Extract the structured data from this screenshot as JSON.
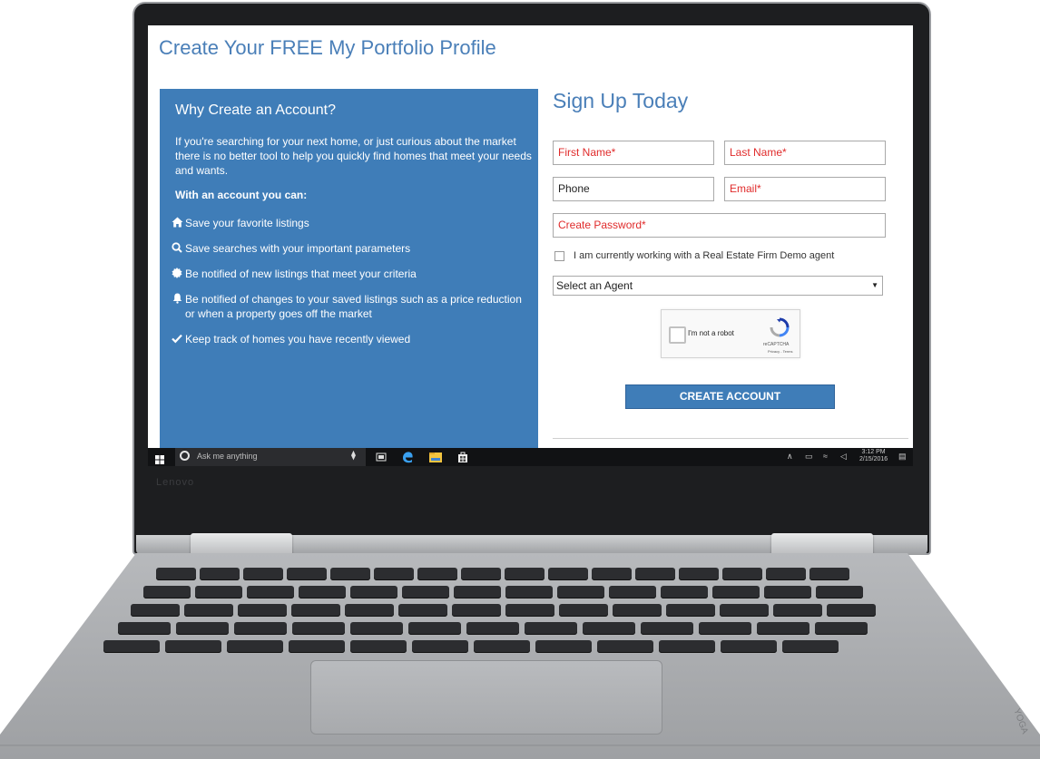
{
  "page": {
    "title": "Create Your FREE My Portfolio Profile"
  },
  "info": {
    "heading": "Why Create an Account?",
    "intro": "If you're searching for your next home, or just curious about the market there is no better tool to help you quickly find homes that meet your needs and wants.",
    "subheading": "With an account you can:",
    "benefits": [
      {
        "icon": "home-icon",
        "text": "Save your favorite listings"
      },
      {
        "icon": "search-icon",
        "text": "Save searches with your important parameters"
      },
      {
        "icon": "badge-icon",
        "text": "Be notified of new listings that meet your criteria"
      },
      {
        "icon": "bell-icon",
        "text": "Be notified of changes to your saved listings such as a price reduction or when a property goes off the market"
      },
      {
        "icon": "check-icon",
        "text": "Keep track of homes you have recently viewed"
      }
    ]
  },
  "form": {
    "title": "Sign Up Today",
    "first_name": "First Name*",
    "last_name": "Last Name*",
    "phone": "Phone",
    "email": "Email*",
    "password": "Create Password*",
    "agent_checkbox_label": "I am currently working with a Real Estate Firm Demo agent",
    "agent_select_value": "Select an Agent",
    "submit_label": "CREATE ACCOUNT",
    "required_color": "#e02b2b"
  },
  "captcha": {
    "label": "I'm not a robot",
    "brand": "reCAPTCHA",
    "terms": "Privacy - Terms"
  },
  "taskbar": {
    "search_placeholder": "Ask me anything",
    "time": "3:12 PM",
    "date": "2/15/2016"
  },
  "device": {
    "brand": "Lenovo",
    "model": "YOGA"
  },
  "colors": {
    "accent": "#3f7db8",
    "title": "#4a7fb8"
  }
}
